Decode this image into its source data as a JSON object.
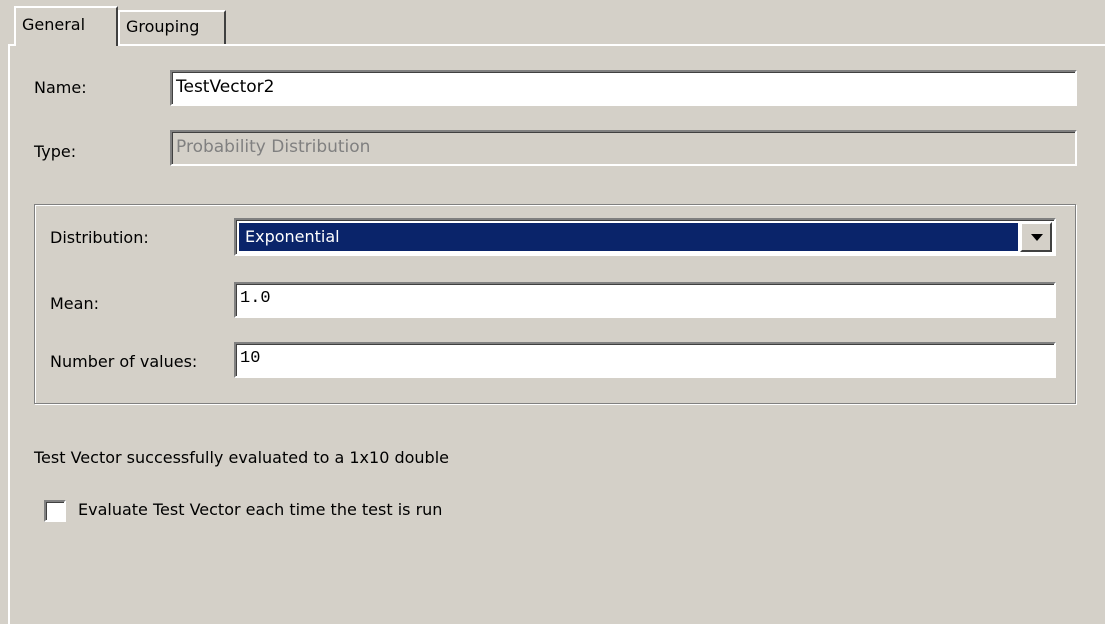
{
  "tabs": [
    {
      "label": "General",
      "active": true
    },
    {
      "label": "Grouping",
      "active": false
    }
  ],
  "general": {
    "name_label": "Name:",
    "name_value": "TestVector2",
    "type_label": "Type:",
    "type_value": "Probability Distribution"
  },
  "distribution_group": {
    "distribution_label": "Distribution:",
    "distribution_value": "Exponential",
    "mean_label": "Mean:",
    "mean_value": "1.0",
    "num_values_label": "Number of values:",
    "num_values_value": "10"
  },
  "status_text": "Test Vector successfully evaluated to a 1x10 double",
  "evaluate_checkbox": {
    "label": "Evaluate Test Vector each time the test is run",
    "checked": false
  },
  "icons": {
    "dropdown": "chevron-down-icon"
  },
  "colors": {
    "background": "#d4d0c8",
    "selection": "#0a246a",
    "disabled_text": "#808080"
  }
}
